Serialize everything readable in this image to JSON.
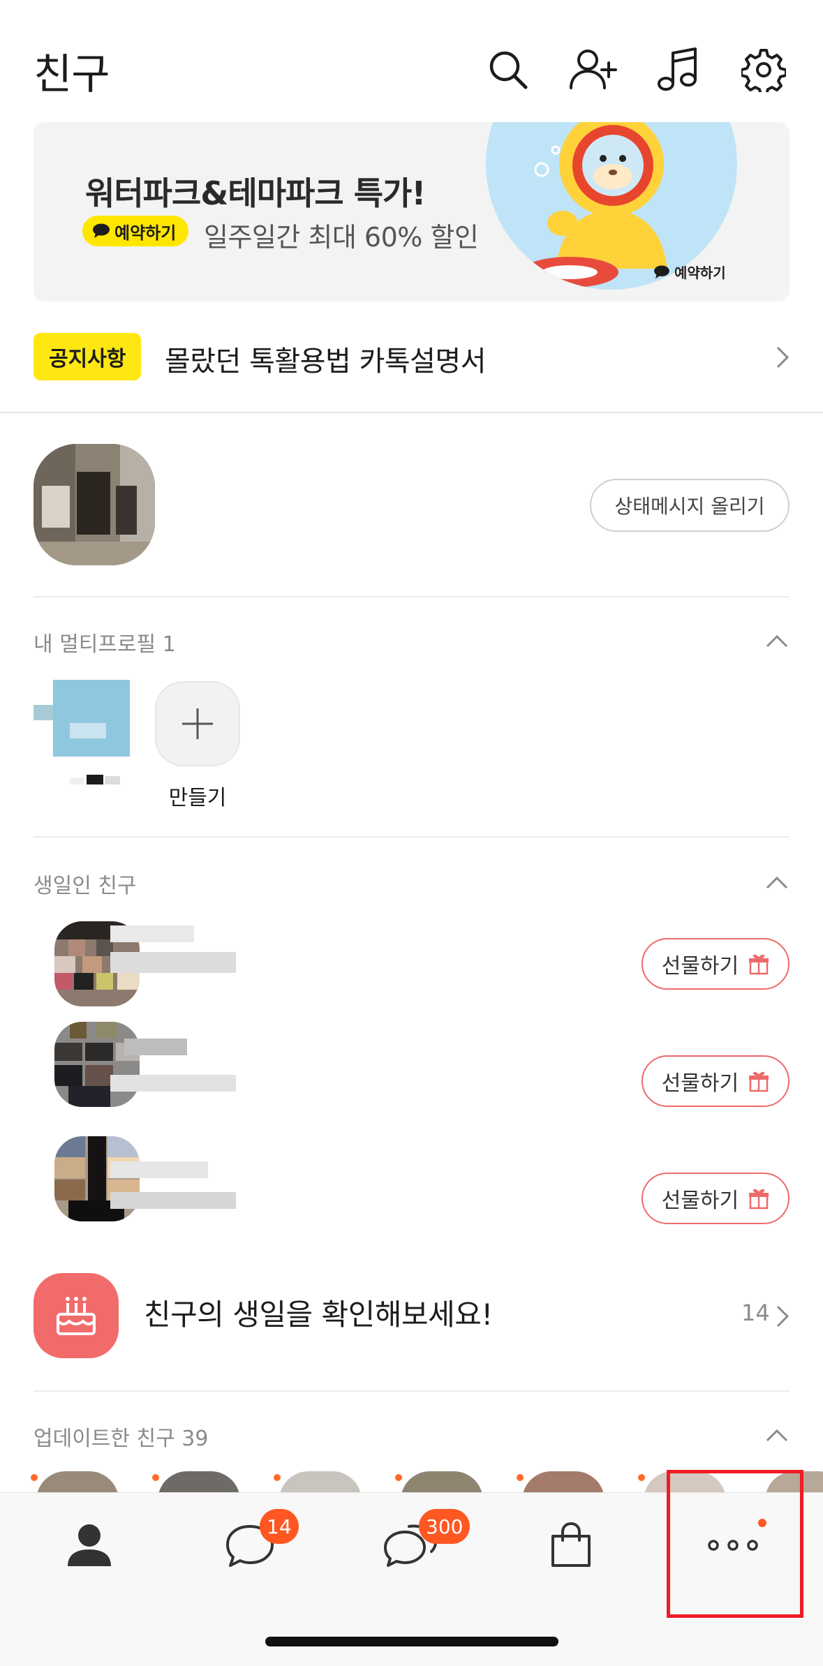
{
  "header": {
    "title": "친구"
  },
  "banner": {
    "title": "워터파크&테마파크 특가!",
    "pill": "예약하기",
    "subtitle": "일주일간 최대 60% 할인",
    "corner_label": "예약하기"
  },
  "notice": {
    "badge": "공지사항",
    "text": "몰랐던 톡활용법 카톡설명서"
  },
  "profile": {
    "status_button": "상태메시지 올리기"
  },
  "multi_profile": {
    "title": "내 멀티프로필 1",
    "make_label": "만들기"
  },
  "birthday": {
    "title": "생일인 친구",
    "gift_label": "선물하기",
    "check_text": "친구의 생일을 확인해보세요!",
    "count": "14"
  },
  "updated": {
    "title": "업데이트한 친구 39"
  },
  "tabbar": {
    "chat_badge": "14",
    "openchat_badge": "300"
  },
  "colors": {
    "accent_yellow": "#ffe812",
    "gift_border": "#ee6a6a",
    "badge_orange": "#ff5722",
    "cake_red": "#f26b6b"
  }
}
